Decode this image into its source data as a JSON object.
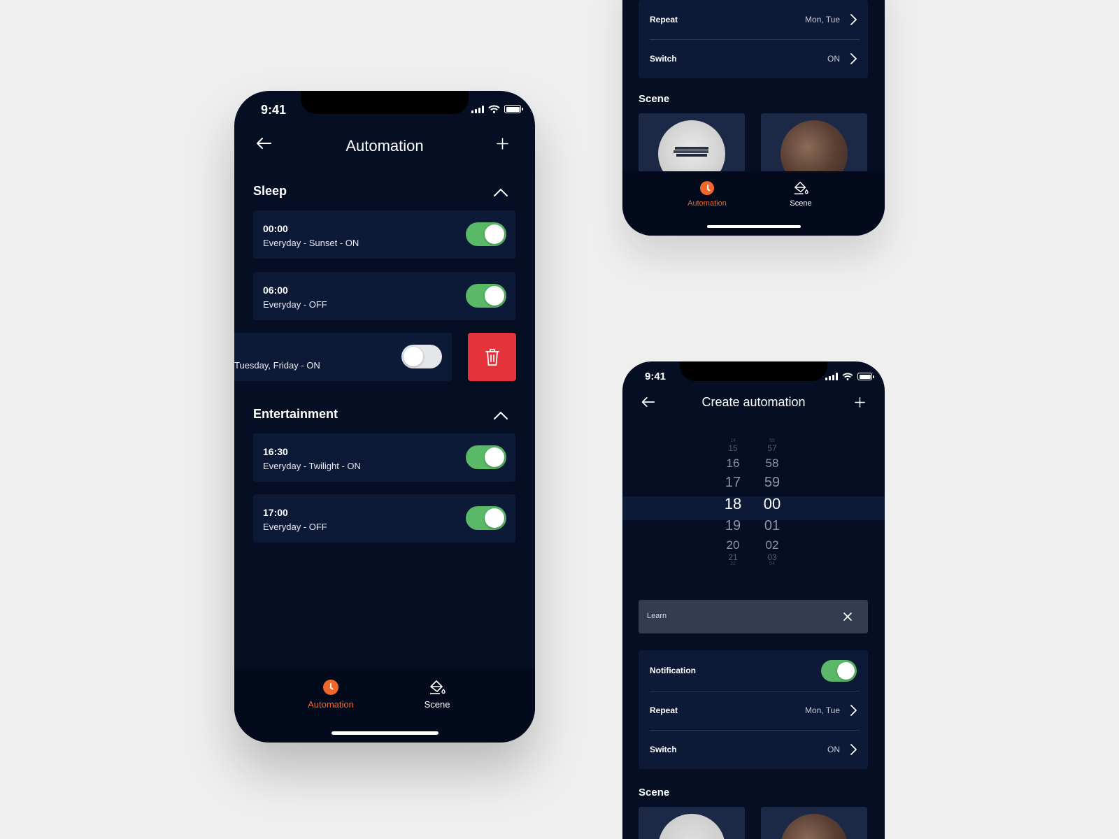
{
  "main_screen": {
    "status_time": "9:41",
    "title": "Automation",
    "sections": [
      {
        "title": "Sleep",
        "items": [
          {
            "time": "00:00",
            "desc": "Everyday - Sunset - ON",
            "enabled": true
          },
          {
            "time": "06:00",
            "desc": "Everyday - OFF",
            "enabled": true
          },
          {
            "time": "",
            "desc": "Tuesday, Friday - ON",
            "enabled": false
          }
        ]
      },
      {
        "title": "Entertainment",
        "items": [
          {
            "time": "16:30",
            "desc": "Everyday - Twilight - ON",
            "enabled": true
          },
          {
            "time": "17:00",
            "desc": "Everyday -  OFF",
            "enabled": true
          }
        ]
      }
    ],
    "tabs": [
      {
        "label": "Automation",
        "active": true,
        "icon": "clock-icon"
      },
      {
        "label": "Scene",
        "active": false,
        "icon": "paint-bucket-icon"
      }
    ]
  },
  "top_screen": {
    "rows": [
      {
        "label": "Repeat",
        "value": "Mon, Tue"
      },
      {
        "label": "Switch",
        "value": "ON"
      }
    ],
    "scene_title": "Scene",
    "tabs": [
      {
        "label": "Automation",
        "active": true
      },
      {
        "label": "Scene",
        "active": false
      }
    ]
  },
  "create_screen": {
    "status_time": "9:41",
    "title": "Create automation",
    "picker": {
      "hours": [
        "14",
        "15",
        "16",
        "17",
        "18",
        "19",
        "20",
        "21",
        "22"
      ],
      "minutes": [
        "56",
        "57",
        "58",
        "59",
        "00",
        "01",
        "02",
        "03",
        "04"
      ],
      "selected_hour": "18",
      "selected_minute": "00"
    },
    "name_input": {
      "value": "Learn"
    },
    "notification": {
      "label": "Notification",
      "enabled": true
    },
    "rows": [
      {
        "label": "Repeat",
        "value": "Mon, Tue"
      },
      {
        "label": "Switch",
        "value": "ON"
      }
    ],
    "scene_title": "Scene"
  },
  "colors": {
    "background": "#efefef",
    "phone_bg": "#050e22",
    "card_bg": "#0d1a37",
    "toggle_on": "#59b966",
    "accent_orange": "#f2662a",
    "delete_red": "#e6323a"
  }
}
